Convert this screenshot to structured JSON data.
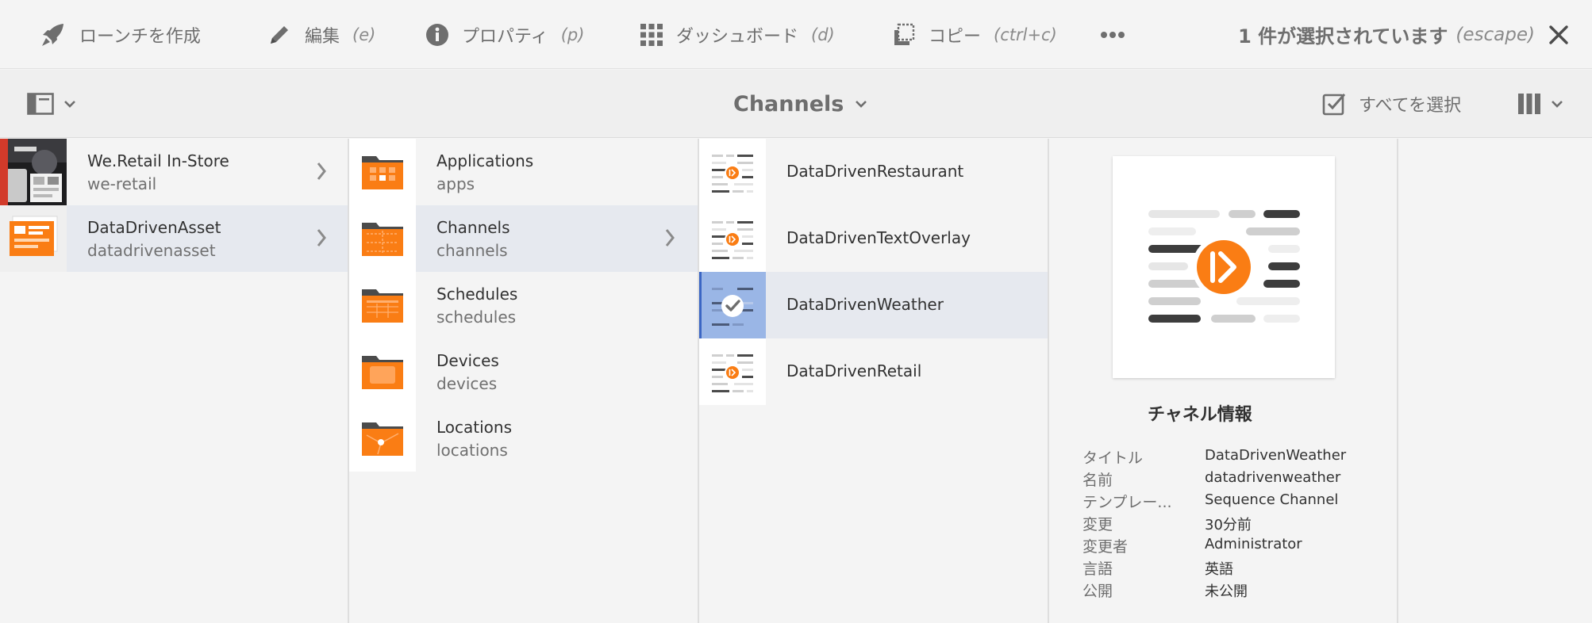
{
  "actionbar": {
    "actions": [
      {
        "label": "ローンチを作成",
        "shortcut": ""
      },
      {
        "label": "編集",
        "shortcut": "(e)"
      },
      {
        "label": "プロパティ",
        "shortcut": "(p)"
      },
      {
        "label": "ダッシュボード",
        "shortcut": "(d)"
      },
      {
        "label": "コピー",
        "shortcut": "(ctrl+c)"
      }
    ],
    "more_icon": "more-icon",
    "selection_text": "1 件が選択されています",
    "selection_shortcut": "(escape)"
  },
  "toolbar": {
    "title": "Channels",
    "select_all": "すべてを選択"
  },
  "columns": {
    "col1": [
      {
        "title": "We.Retail In-Store",
        "name": "we-retail"
      },
      {
        "title": "DataDrivenAsset",
        "name": "datadrivenasset"
      }
    ],
    "col2": [
      {
        "title": "Applications",
        "name": "apps"
      },
      {
        "title": "Channels",
        "name": "channels"
      },
      {
        "title": "Schedules",
        "name": "schedules"
      },
      {
        "title": "Devices",
        "name": "devices"
      },
      {
        "title": "Locations",
        "name": "locations"
      }
    ],
    "col3": [
      {
        "title": "DataDrivenRestaurant"
      },
      {
        "title": "DataDrivenTextOverlay"
      },
      {
        "title": "DataDrivenWeather"
      },
      {
        "title": "DataDrivenRetail"
      }
    ]
  },
  "preview": {
    "heading": "チャネル情報",
    "fields": [
      {
        "key": "タイトル",
        "value": "DataDrivenWeather"
      },
      {
        "key": "名前",
        "value": "datadrivenweather"
      },
      {
        "key": "テンプレー...",
        "value": "Sequence Channel"
      },
      {
        "key": "変更",
        "value": "30分前"
      },
      {
        "key": "変更者",
        "value": "Administrator"
      },
      {
        "key": "言語",
        "value": "英語"
      },
      {
        "key": "公開",
        "value": "未公開"
      }
    ]
  },
  "colors": {
    "accent_orange": "#fa7d14",
    "selection_blue": "#3b66c4",
    "selected_thumb": "#9ab6e6",
    "highlight_row": "#e6e9ef"
  }
}
